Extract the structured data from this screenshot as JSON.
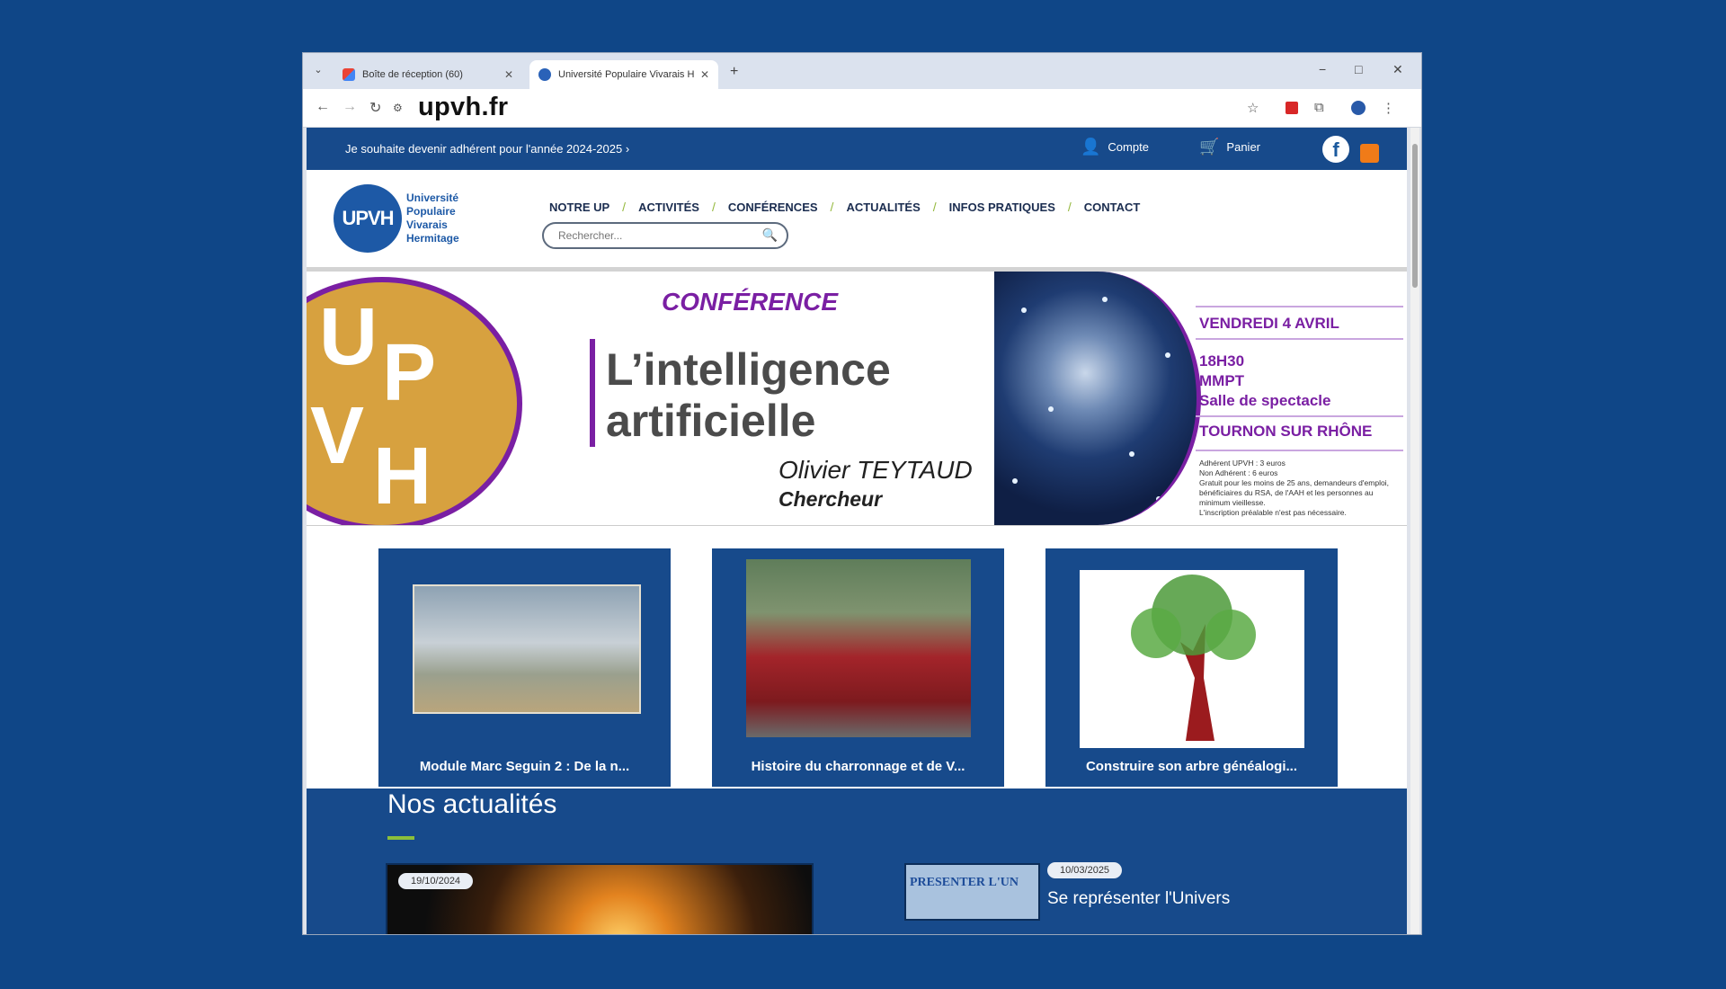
{
  "browser": {
    "tabs": [
      {
        "title": "Boîte de réception (60)",
        "active": false
      },
      {
        "title": "Université Populaire Vivarais H",
        "active": true
      }
    ],
    "url": "upvh.fr",
    "new_tab": "+",
    "window_controls": [
      "−",
      "□",
      "✕"
    ]
  },
  "site": {
    "topbar": {
      "join_text": "Je souhaite devenir adhérent pour l'année 2024-2025 ›",
      "account_label": "Compte",
      "cart_label": "Panier"
    },
    "logo": {
      "mark": "UPVH",
      "lines": [
        "Université",
        "Populaire",
        "Vivarais",
        "Hermitage"
      ]
    },
    "menu": [
      "NOTRE UP",
      "ACTIVITÉS",
      "CONFÉRENCES",
      "ACTUALITÉS",
      "INFOS PRATIQUES",
      "CONTACT"
    ],
    "search_placeholder": "Rechercher..."
  },
  "banner": {
    "kicker": "CONFÉRENCE",
    "title_line1": "L’intelligence",
    "title_line2": "artificielle",
    "speaker": "Olivier TEYTAUD",
    "role": "Chercheur",
    "date": "VENDREDI 4 AVRIL",
    "time": "18H30",
    "venue1": "MMPT",
    "venue2": "Salle de spectacle",
    "city": "TOURNON SUR RHÔNE",
    "fine_print": "Adhérent UPVH : 3 euros\nNon Adhérent : 6 euros\nGratuit pour les moins de 25 ans, demandeurs d'emploi, bénéficiaires du RSA, de l'AAH et les personnes au minimum vieillesse.\nL'inscription préalable n'est pas nécessaire.",
    "logo_letters": [
      "U",
      "P",
      "V",
      "H"
    ]
  },
  "cards": [
    {
      "label": "Module Marc Seguin 2 : De la n..."
    },
    {
      "label": "Histoire du charronnage et de V..."
    },
    {
      "label": "Construire son arbre généalogi..."
    }
  ],
  "news": {
    "heading": "Nos actualités",
    "items": [
      {
        "date": "19/10/2024",
        "title": ""
      },
      {
        "date": "10/03/2025",
        "title": "Se représenter l'Univers",
        "thumb_text": "PRESENTER   L'UN"
      }
    ]
  },
  "colors": {
    "background": "#0f4687",
    "site_blue": "#174a8b",
    "purple": "#7a1fa3",
    "gold": "#d7a13f",
    "green_accent": "#8bbf3a"
  }
}
